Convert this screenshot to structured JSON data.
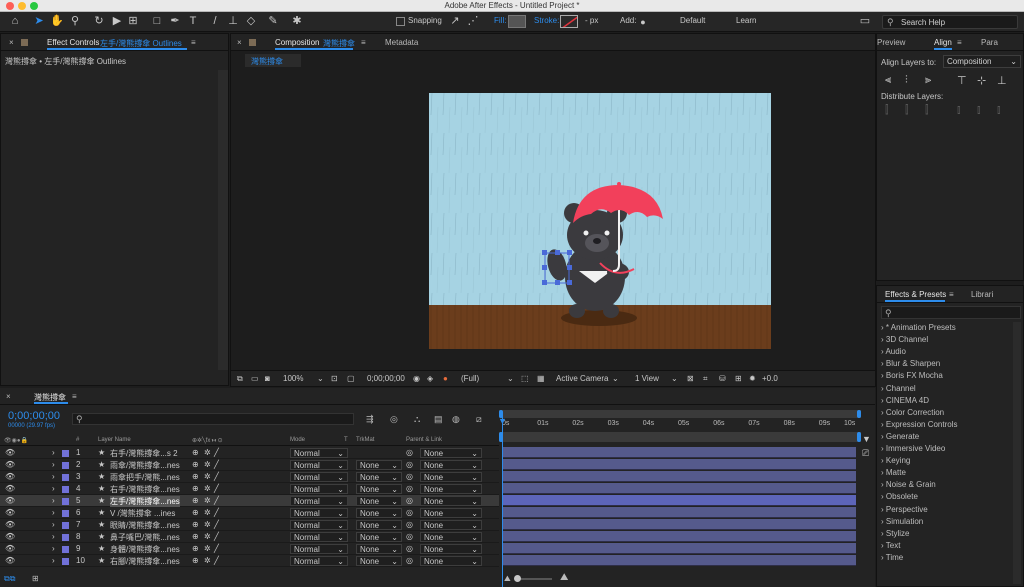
{
  "window": {
    "title": "Adobe After Effects - Untitled Project *"
  },
  "toolbar": {
    "snapping_label": "Snapping",
    "fill_label": "Fill:",
    "stroke_label": "Stroke:",
    "stroke_px": "- px",
    "add_label": "Add:",
    "workspace_default": "Default",
    "workspace_learn": "Learn",
    "search_placeholder": "Search Help"
  },
  "effect_controls": {
    "tab_label": "Effect Controls",
    "tab_layer": "左手/灣熊撐傘 Outlines",
    "path_text": "灣熊撐傘 • 左手/灣熊撐傘 Outlines"
  },
  "composition": {
    "tab_label": "Composition",
    "tab_name": "灣熊撐傘",
    "metadata_tab": "Metadata",
    "subtab": "灣熊撐傘"
  },
  "viewer_bar": {
    "zoom": "100%",
    "timecode": "0;00;00;00",
    "resolution": "(Full)",
    "camera": "Active Camera",
    "views": "1 View",
    "exposure": "+0.0"
  },
  "align_panel": {
    "tabs": [
      "Preview",
      "Align",
      "Para"
    ],
    "align_to_label": "Align Layers to:",
    "align_to_value": "Composition",
    "distribute_label": "Distribute Layers:"
  },
  "effects_panel": {
    "tab_label": "Effects & Presets",
    "libraries_tab": "Librari",
    "items": [
      "* Animation Presets",
      "3D Channel",
      "Audio",
      "Blur & Sharpen",
      "Boris FX Mocha",
      "Channel",
      "CINEMA 4D",
      "Color Correction",
      "Expression Controls",
      "Generate",
      "Immersive Video",
      "Keying",
      "Matte",
      "Noise & Grain",
      "Obsolete",
      "Perspective",
      "Simulation",
      "Stylize",
      "Text",
      "Time"
    ]
  },
  "timeline": {
    "tab_label": "灣熊撐傘",
    "timecode": "0;00;00;00",
    "fps": "00000 (29.97 fps)",
    "headers": {
      "num": "#",
      "layer_name": "Layer Name",
      "mode": "Mode",
      "t": "T",
      "trkmat": "TrkMat",
      "parent": "Parent & Link"
    },
    "ruler": [
      "0s",
      "01s",
      "02s",
      "03s",
      "04s",
      "05s",
      "06s",
      "07s",
      "08s",
      "09s",
      "10s"
    ],
    "layers": [
      {
        "num": "1",
        "name": "右手/灣熊撐傘...s 2",
        "mode": "Normal",
        "trkmat": "",
        "parent": "None"
      },
      {
        "num": "2",
        "name": "雨傘/灣熊撐傘...nes",
        "mode": "Normal",
        "trkmat": "None",
        "parent": "None"
      },
      {
        "num": "3",
        "name": "雨傘把手/灣熊...nes",
        "mode": "Normal",
        "trkmat": "None",
        "parent": "None"
      },
      {
        "num": "4",
        "name": "右手/灣熊撐傘...nes",
        "mode": "Normal",
        "trkmat": "None",
        "parent": "None"
      },
      {
        "num": "5",
        "name": "左手/灣熊撐傘...nes",
        "mode": "Normal",
        "trkmat": "None",
        "parent": "None"
      },
      {
        "num": "6",
        "name": "V /灣熊撐傘 ...ines",
        "mode": "Normal",
        "trkmat": "None",
        "parent": "None"
      },
      {
        "num": "7",
        "name": "眼睛/灣熊撐傘...nes",
        "mode": "Normal",
        "trkmat": "None",
        "parent": "None"
      },
      {
        "num": "8",
        "name": "鼻子嘴巴/灣熊...nes",
        "mode": "Normal",
        "trkmat": "None",
        "parent": "None"
      },
      {
        "num": "9",
        "name": "身體/灣熊撐傘...nes",
        "mode": "Normal",
        "trkmat": "None",
        "parent": "None"
      },
      {
        "num": "10",
        "name": "右腳/灣熊撐傘...nes",
        "mode": "Normal",
        "trkmat": "None",
        "parent": "None"
      }
    ],
    "selected_index": 4
  },
  "colors": {
    "accent": "#2d8ceb",
    "layer_label": "#7171d8",
    "layer_bar": "#555a8c",
    "sky": "#a6d3e3",
    "ground": "#6b3d1c",
    "umbrella": "#f2405b",
    "bear": "#3b3a3e"
  }
}
